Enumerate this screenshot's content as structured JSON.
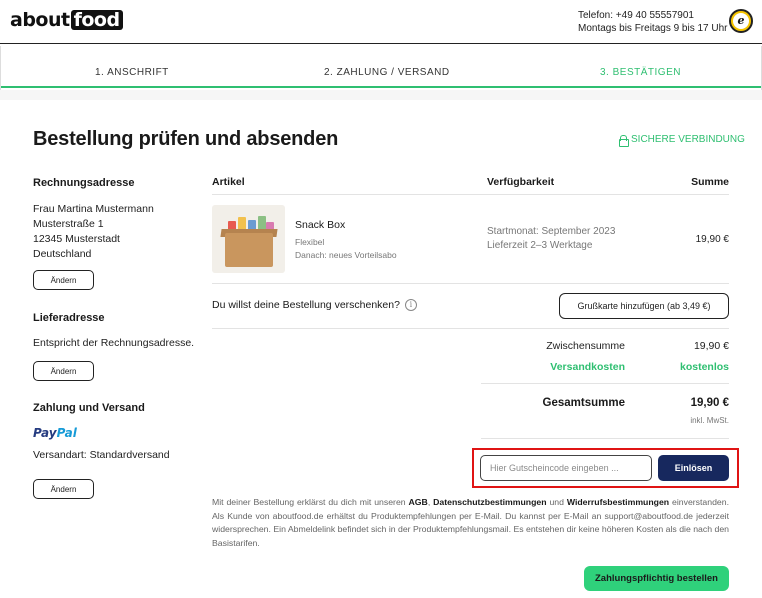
{
  "header": {
    "logo_about": "about",
    "logo_food": "food",
    "phone": "Telefon: +49 40 55557901",
    "hours": "Montags bis Freitags 9 bis 17 Uhr",
    "trust_badge_letter": "e"
  },
  "steps": [
    {
      "label": "1. ANSCHRIFT",
      "active": false
    },
    {
      "label": "2. ZAHLUNG / VERSAND",
      "active": false
    },
    {
      "label": "3. BESTÄTIGEN",
      "active": true
    }
  ],
  "page": {
    "title": "Bestellung prüfen und absenden",
    "secure_label": "SICHERE VERBINDUNG"
  },
  "billing": {
    "heading": "Rechnungsadresse",
    "lines": [
      "Frau Martina Mustermann",
      "Musterstraße 1",
      "12345 Musterstadt",
      "Deutschland"
    ],
    "change_label": "Ändern"
  },
  "shipping": {
    "heading": "Lieferadresse",
    "text": "Entspricht der Rechnungsadresse.",
    "change_label": "Ändern"
  },
  "payment": {
    "heading": "Zahlung und Versand",
    "paypal_1": "Pay",
    "paypal_2": "Pal",
    "shipping_type": "Versandart: Standardversand",
    "change_label": "Ändern"
  },
  "table": {
    "headers": {
      "article": "Artikel",
      "availability": "Verfügbarkeit",
      "sum": "Summe"
    },
    "item": {
      "name": "Snack Box",
      "variant": "Flexibel",
      "after": "Danach: neues Vorteilsabo",
      "start": "Startmonat: September 2023",
      "delivery": "Lieferzeit 2–3 Werktage",
      "price": "19,90 €"
    }
  },
  "gift": {
    "question": "Du willst deine Bestellung verschenken?",
    "info_glyph": "i",
    "button": "Grußkarte hinzufügen (ab 3,49 €)"
  },
  "totals": {
    "subtotal_label": "Zwischensumme",
    "subtotal": "19,90 €",
    "shipping_label": "Versandkosten",
    "shipping": "kostenlos",
    "total_label": "Gesamtsumme",
    "total": "19,90 €",
    "vat": "inkl. MwSt."
  },
  "voucher": {
    "placeholder": "Hier Gutscheincode eingeben ...",
    "button": "Einlösen"
  },
  "legal": {
    "p1": "Mit deiner Bestellung erklärst du dich mit unseren ",
    "agb": "AGB",
    "sep1": ", ",
    "privacy": "Datenschutzbestimmungen",
    "sep2": " und ",
    "withdrawal": "Widerrufsbestimmungen",
    "p2": " einverstanden. Als Kunde von aboutfood.de erhältst du Produktempfehlungen per E-Mail. Du kannst per E-Mail an support@aboutfood.de jederzeit widersprechen. Ein Abmeldelink befindet sich in der Produktempfehlungsmail. Es entstehen dir keine höheren Kosten als die nach den Basistarifen."
  },
  "order_button": "Zahlungspflichtig bestellen",
  "colors": {
    "accent_green": "#2fbf71",
    "navy": "#17285e",
    "highlight_red": "#e01414"
  }
}
